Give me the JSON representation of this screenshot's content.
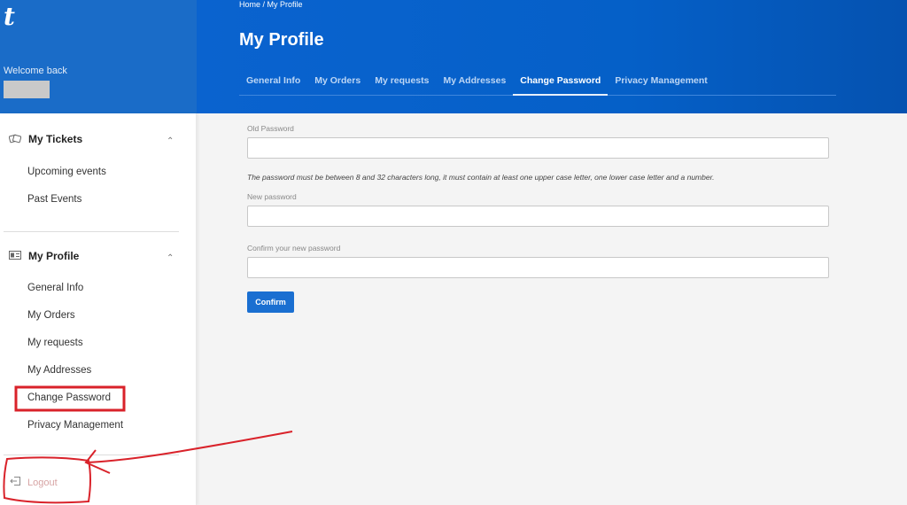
{
  "brand": {
    "logo": "t",
    "welcome": "Welcome back"
  },
  "header": {
    "breadcrumb": "Home / My Profile",
    "title": "My Profile",
    "tabs": [
      {
        "label": "General Info",
        "active": false
      },
      {
        "label": "My Orders",
        "active": false
      },
      {
        "label": "My requests",
        "active": false
      },
      {
        "label": "My Addresses",
        "active": false
      },
      {
        "label": "Change Password",
        "active": true
      },
      {
        "label": "Privacy Management",
        "active": false
      }
    ]
  },
  "sidebar": {
    "tickets": {
      "title": "My Tickets",
      "icon": "tickets-icon",
      "items": [
        "Upcoming events",
        "Past Events"
      ]
    },
    "profile": {
      "title": "My Profile",
      "icon": "id-card-icon",
      "items": [
        "General Info",
        "My Orders",
        "My requests",
        "My Addresses",
        "Change Password",
        "Privacy Management"
      ]
    },
    "logout": "Logout"
  },
  "form": {
    "old_password_label": "Old Password",
    "old_password_value": "",
    "hint": "The password must be between 8 and 32 characters long, it must contain at least one upper case letter, one lower case letter and a number.",
    "new_password_label": "New password",
    "new_password_value": "",
    "confirm_password_label": "Confirm your new password",
    "confirm_password_value": "",
    "confirm_button": "Confirm"
  },
  "annotation": {
    "color": "#d9222a"
  },
  "colors": {
    "header_blue": "#0a63cf",
    "button_blue": "#1a6fd1"
  }
}
